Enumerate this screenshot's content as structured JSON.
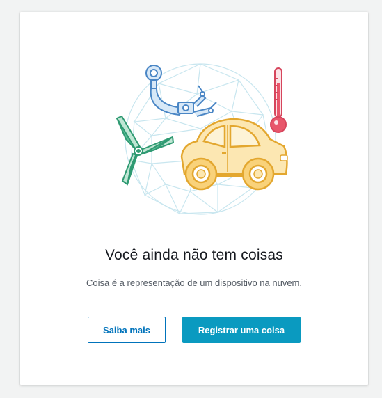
{
  "empty_state": {
    "title": "Você ainda não tem coisas",
    "description": "Coisa é a representação de um dispositivo na nuvem.",
    "learn_more_label": "Saiba mais",
    "register_label": "Registrar uma coisa"
  },
  "illustration": {
    "icons": [
      "robotic-arm-icon",
      "thermometer-icon",
      "wind-turbine-icon",
      "car-icon",
      "geodesic-sphere-icon"
    ]
  },
  "colors": {
    "primary_button": "#0a9ac0",
    "link_blue": "#0073bb",
    "car_yellow": "#f9d27a",
    "turbine_green": "#5bbd97",
    "thermo_red": "#e8566b",
    "arm_blue": "#6aa6d9",
    "sphere_lines": "#c8e6ef"
  }
}
